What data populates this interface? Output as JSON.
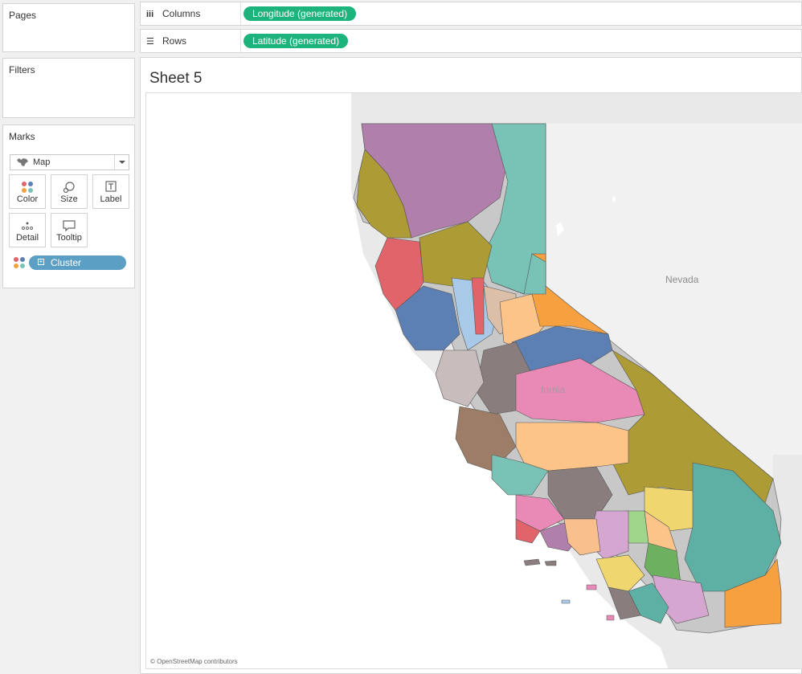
{
  "panels": {
    "pages": {
      "title": "Pages"
    },
    "filters": {
      "title": "Filters"
    },
    "marks": {
      "title": "Marks",
      "mark_type": "Map",
      "buttons": {
        "color": "Color",
        "size": "Size",
        "label": "Label",
        "detail": "Detail",
        "tooltip": "Tooltip"
      },
      "field_pill": "Cluster"
    }
  },
  "shelves": {
    "columns": {
      "label": "Columns",
      "pill": "Longitude (generated)"
    },
    "rows": {
      "label": "Rows",
      "pill": "Latitude (generated)"
    }
  },
  "view": {
    "sheet_title": "Sheet 5",
    "map": {
      "state_label": "Nevada",
      "faint_label": "fornia",
      "attribution": "© OpenStreetMap contributors"
    }
  },
  "colors": {
    "pill_green": "#1db37c",
    "pill_blue": "#5b9fc5",
    "cluster_palette": [
      "#b07fab",
      "#79c2b6",
      "#ad9b36",
      "#e0646a",
      "#5c80b3",
      "#f6a03f",
      "#a8c9e8",
      "#9d7d67",
      "#e989b5",
      "#fdc48a",
      "#efd66f",
      "#8a7d7d",
      "#5db0a3",
      "#6db05f"
    ]
  }
}
